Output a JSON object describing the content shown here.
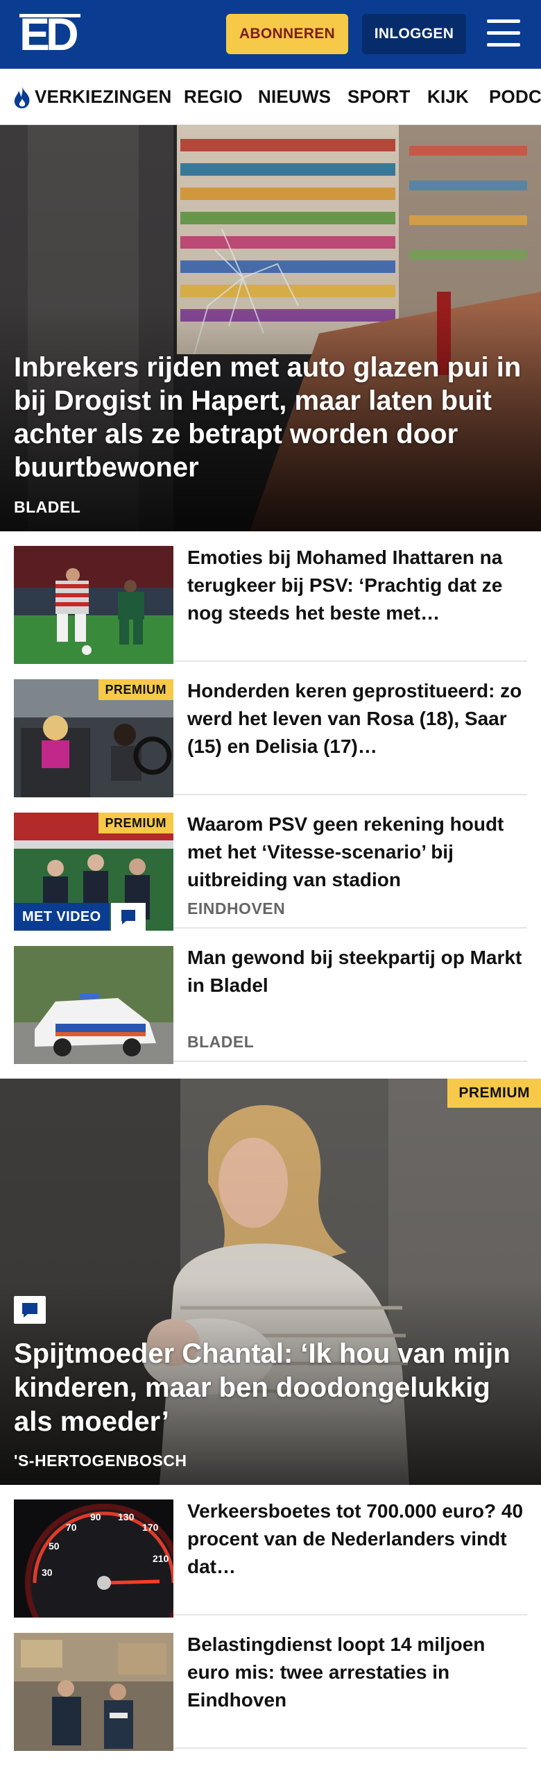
{
  "header": {
    "logo_text": "ED",
    "subscribe_label": "ABONNEREN",
    "login_label": "INLOGGEN",
    "brand_color": "#0a3d91",
    "subscribe_color": "#f7c948"
  },
  "nav": {
    "items": [
      "VERKIEZINGEN",
      "REGIO",
      "NIEUWS",
      "SPORT",
      "KIJK",
      "PODC"
    ],
    "first_icon": "flame-icon"
  },
  "hero": {
    "title": "Inbrekers rijden met auto glazen pui in bij Drogist in Hapert, maar laten buit achter als ze betrapt worden door buurtbewoner",
    "location": "BLADEL"
  },
  "articles": [
    {
      "title": "Emoties bij Mohamed Ihattaren na terugkeer bij PSV: ‘Prachtig dat ze nog steeds het beste met…",
      "premium": "",
      "video": "",
      "location": ""
    },
    {
      "title": "Honderden keren geprostitueerd: zo werd het leven van Rosa (18), Saar (15) en Delisia (17)…",
      "premium": "PREMIUM",
      "video": "",
      "location": ""
    },
    {
      "title": "Waarom PSV geen rekening houdt met het ‘Vitesse-scenario’ bij uitbreiding van stadion",
      "premium": "PREMIUM",
      "video": "MET VIDEO",
      "location": "EINDHOVEN"
    },
    {
      "title": "Man gewond bij steekpartij op Markt in Bladel",
      "premium": "",
      "video": "",
      "location": "BLADEL"
    }
  ],
  "feature": {
    "premium": "PREMIUM",
    "title": "Spijtmoeder Chantal: ‘Ik hou van mijn kinderen, maar ben doodongelukkig als moeder’",
    "location": "'S-HERTOGENBOSCH"
  },
  "articles2": [
    {
      "title": "Verkeersboetes tot 700.000 euro? 40 procent van de Nederlanders vindt dat…"
    },
    {
      "title": "Belastingdienst loopt 14 miljoen euro mis: twee arrestaties in Eindhoven"
    }
  ]
}
